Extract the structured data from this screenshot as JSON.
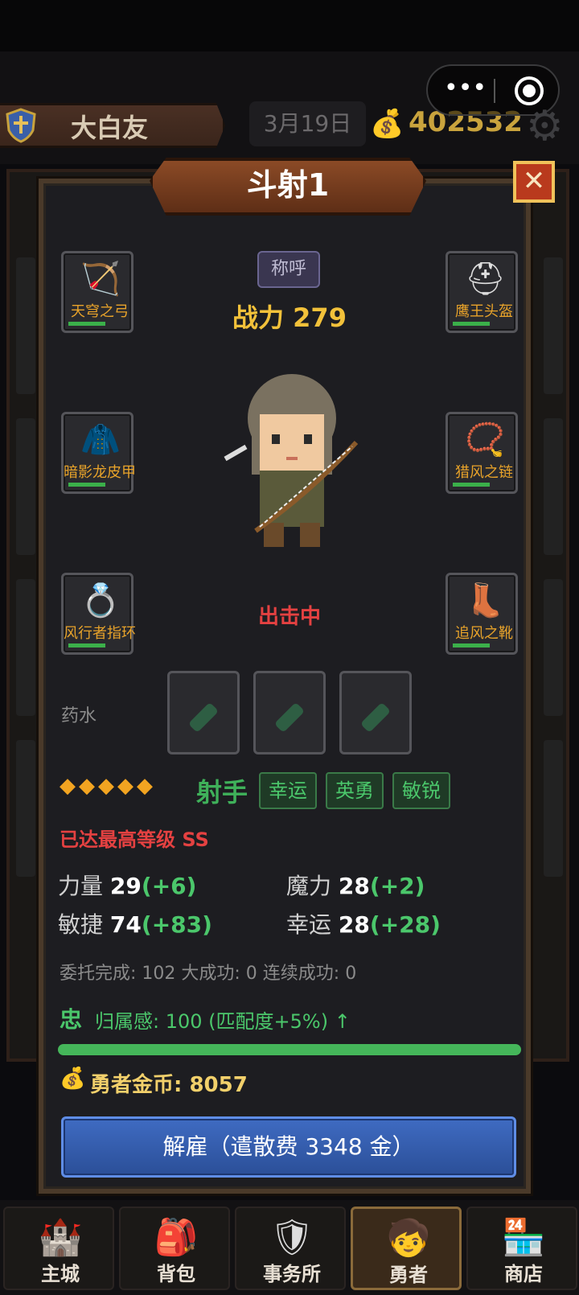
{
  "topbar": {
    "player_name": "大白友",
    "date": "3月19日",
    "gold": "402532",
    "capsule_more": "•••"
  },
  "dialog": {
    "title": "斗射1",
    "close_label": "✕",
    "title_badge": "称呼",
    "power": "战力 279",
    "status": "出击中",
    "equipment": {
      "weapon": "天穹之弓",
      "helmet": "鹰王头盔",
      "armor": "暗影龙皮甲",
      "necklace": "猎风之链",
      "ring": "风行者指环",
      "boots": "追风之靴"
    },
    "potion_label": "药水",
    "stars": "◆◆◆◆◆",
    "class_name": "射手",
    "traits": [
      "幸运",
      "英勇",
      "敏锐"
    ],
    "max_level": "已达最高等级 SS",
    "stats": {
      "str_label": "力量",
      "str_val": "29",
      "str_bonus": "(+6)",
      "mag_label": "魔力",
      "mag_val": "28",
      "mag_bonus": "(+2)",
      "agi_label": "敏捷",
      "agi_val": "74",
      "agi_bonus": "(+83)",
      "luk_label": "幸运",
      "luk_val": "28",
      "luk_bonus": "(+28)"
    },
    "quest_line": "委托完成: 102  大成功: 0  连续成功: 0",
    "loyalty_icon": "忠",
    "loyalty_text": "归属感: 100 (匹配度+5%) ↑",
    "loyalty_value": 100,
    "coins": "勇者金币: 8057",
    "dismiss_label": "解雇（遣散费 3348 金）"
  },
  "nav": [
    {
      "label": "主城",
      "icon": "castle-icon"
    },
    {
      "label": "背包",
      "icon": "bag-icon"
    },
    {
      "label": "事务所",
      "icon": "shield-icon"
    },
    {
      "label": "勇者",
      "icon": "hero-icon"
    },
    {
      "label": "商店",
      "icon": "shop-icon"
    }
  ],
  "colors": {
    "accent_gold": "#f2c13a",
    "accent_green": "#4bc76b",
    "accent_red": "#e44141",
    "button_blue": "#3f6bc2"
  }
}
